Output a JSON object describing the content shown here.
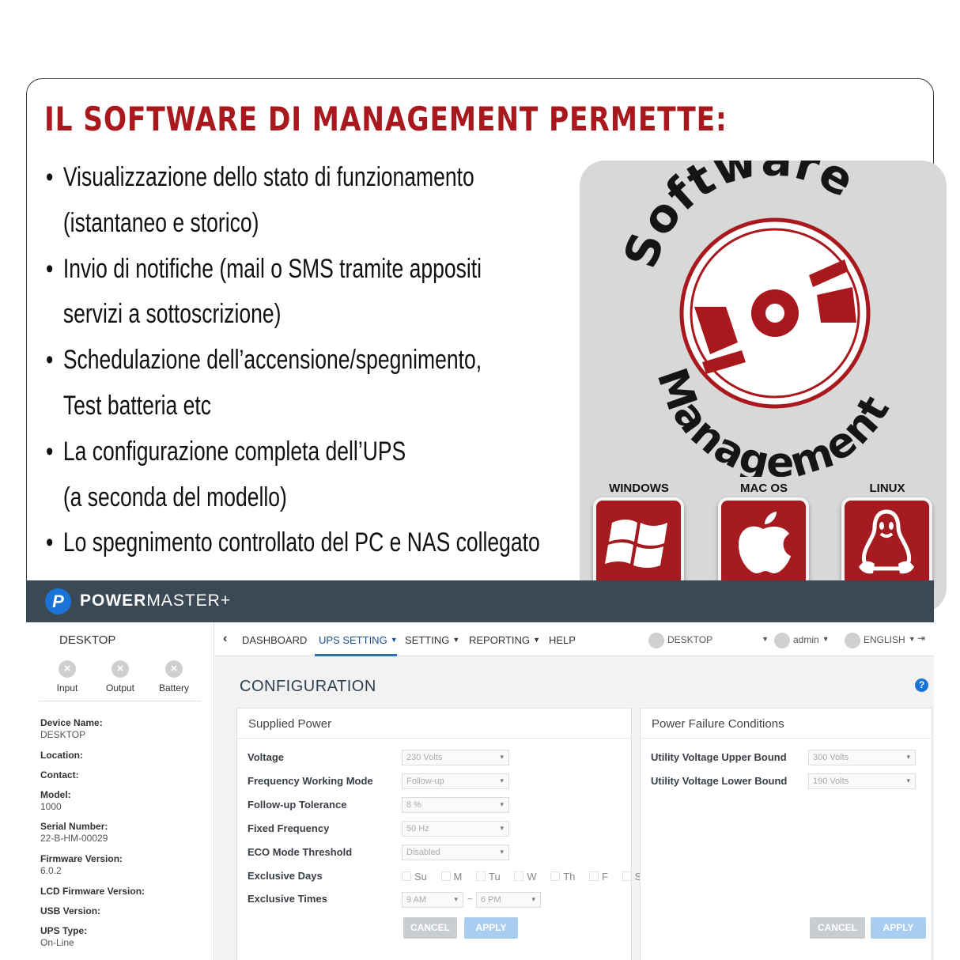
{
  "headline": "IL SOFTWARE DI MANAGEMENT PERMETTE:",
  "bullets": [
    {
      "line1": "Visualizzazione dello stato di funzionamento",
      "line2": "(istantaneo e storico)"
    },
    {
      "line1": "Invio di notifiche (mail  o SMS tramite appositi",
      "line2": "servizi a sottoscrizione)"
    },
    {
      "line1": "Schedulazione dell’accensione/spegnimento,",
      "line2": "Test batteria etc"
    },
    {
      "line1": "La configurazione completa dell’UPS",
      "line2": "(a seconda del modello)"
    },
    {
      "line1": "Lo spegnimento controllato del PC e NAS collegato",
      "line2": ""
    }
  ],
  "badge": {
    "top_text": "Software",
    "bottom_text": "Management",
    "accent": "#a8181c"
  },
  "os": [
    {
      "label": "WINDOWS",
      "icon": "windows-icon"
    },
    {
      "label": "MAC OS",
      "icon": "apple-icon"
    },
    {
      "label": "LINUX",
      "icon": "linux-tux-icon"
    }
  ],
  "app": {
    "brand_bold": "POWER",
    "brand_light": "MASTER+",
    "sidebar": {
      "title": "DESKTOP",
      "statuses": [
        "Input",
        "Output",
        "Battery"
      ],
      "info": [
        {
          "k": "Device Name:",
          "v": "DESKTOP"
        },
        {
          "k": "Location:",
          "v": ""
        },
        {
          "k": "Contact:",
          "v": ""
        },
        {
          "k": "Model:",
          "v": "1000"
        },
        {
          "k": "Serial Number:",
          "v": "22-B-HM-00029"
        },
        {
          "k": "Firmware Version:",
          "v": "6.0.2"
        },
        {
          "k": "LCD Firmware Version:",
          "v": ""
        },
        {
          "k": "USB Version:",
          "v": ""
        },
        {
          "k": "UPS Type:",
          "v": "On-Line"
        }
      ]
    },
    "nav": {
      "items": [
        "DASHBOARD",
        "UPS SETTING",
        "SETTING",
        "REPORTING",
        "HELP"
      ],
      "device": "DESKTOP",
      "user": "admin",
      "language": "ENGLISH"
    },
    "config_title": "CONFIGURATION",
    "supplied": {
      "title": "Supplied Power",
      "rows": [
        {
          "label": "Voltage",
          "value": "230 Volts"
        },
        {
          "label": "Frequency Working Mode",
          "value": "Follow-up"
        },
        {
          "label": "Follow-up Tolerance",
          "value": "8 %"
        },
        {
          "label": "Fixed Frequency",
          "value": "50 Hz"
        },
        {
          "label": "ECO Mode Threshold",
          "value": "Disabled"
        }
      ],
      "days_label": "Exclusive Days",
      "days": [
        "Su",
        "M",
        "Tu",
        "W",
        "Th",
        "F",
        "Sa"
      ],
      "times_label": "Exclusive Times",
      "time_from": "9 AM",
      "time_sep": "~",
      "time_to": "6 PM",
      "cancel": "CANCEL",
      "apply": "APPLY"
    },
    "failure": {
      "title": "Power Failure Conditions",
      "rows": [
        {
          "label": "Utility Voltage Upper Bound",
          "value": "300 Volts"
        },
        {
          "label": "Utility Voltage Lower Bound",
          "value": "190 Volts"
        }
      ],
      "cancel": "CANCEL",
      "apply": "APPLY"
    }
  }
}
